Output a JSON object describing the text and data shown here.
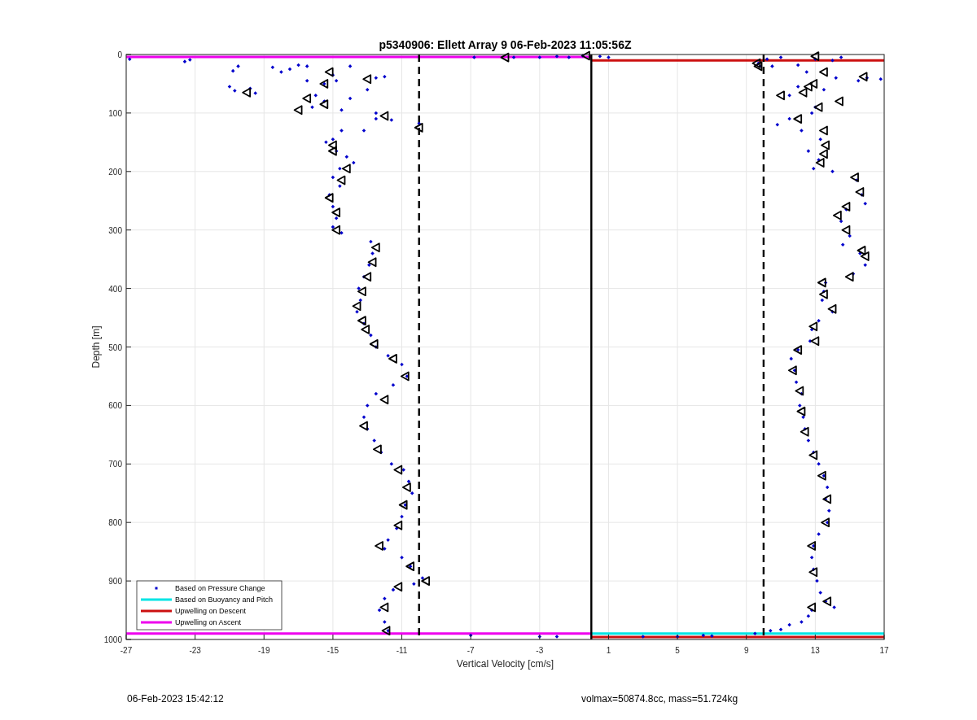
{
  "figure": {
    "chart_data": {
      "type": "scatter",
      "title": "p5340906: Ellett Array 9 06-Feb-2023 11:05:56Z",
      "xlabel": "Vertical Velocity [cm/s]",
      "ylabel": "Depth [m]",
      "xlim": [
        -27,
        17
      ],
      "ylim": [
        1000,
        0
      ],
      "xticks": [
        -27,
        -23,
        -19,
        -15,
        -11,
        -7,
        -3,
        1,
        5,
        9,
        13,
        17
      ],
      "yticks": [
        0,
        100,
        200,
        300,
        400,
        500,
        600,
        700,
        800,
        900,
        1000
      ],
      "series": [
        {
          "name": "Based on Pressure Change",
          "type": "scatter",
          "marker": "diamond",
          "color": "#0000cc",
          "x": [
            -26.8,
            -23.6,
            -23.3,
            -20.5,
            -20.8,
            -21,
            -20.7,
            -19.8,
            -19.5,
            -18.5,
            -18,
            -17.5,
            -17,
            -16.5,
            -16.5,
            -16,
            -15.5,
            -15,
            -14.8,
            -14,
            -12.5,
            -12,
            -13,
            -14,
            -15.5,
            -16.2,
            -14.5,
            -12.5,
            -12.5,
            -11.6,
            -10,
            -13.2,
            -14.5,
            -15,
            -15.4,
            -14.8,
            -14.2,
            -13.8,
            -14.6,
            -15,
            -14.6,
            -15.2,
            -15,
            -14.8,
            -15,
            -14.5,
            -12.8,
            -12.7,
            -12.9,
            -13.2,
            -13.5,
            -13.4,
            -13.6,
            -13.2,
            -12.8,
            -12.5,
            -11.8,
            -11,
            -10.7,
            -11.5,
            -12.5,
            -13,
            -13.2,
            -13,
            -12.6,
            -12.2,
            -11.6,
            -10.9,
            -10.6,
            -10.4,
            -10.8,
            -11,
            -11.3,
            -11.8,
            -12,
            -11,
            -10.5,
            -9.8,
            -10.3,
            -11.5,
            -12,
            -12.3,
            -12,
            -11.8,
            -7,
            -3,
            -2,
            -6.8,
            -4.5,
            -3,
            -2,
            -1.3,
            -0.5,
            0.5,
            1,
            9.7,
            9.8,
            10.2,
            10.5,
            11,
            12,
            13,
            14,
            14.5,
            15.5,
            16,
            16.8,
            12.5,
            11.5,
            12,
            13.5,
            14.2,
            13,
            12.8,
            11.5,
            10.8,
            12.2,
            13.3,
            12.6,
            13.2,
            12.9,
            14,
            15.4,
            15.7,
            15.9,
            14.8,
            14.5,
            15,
            14.6,
            15.6,
            15.9,
            15.2,
            13.6,
            13.5,
            13.4,
            14,
            13.2,
            12.8,
            12.7,
            12,
            11.6,
            11.8,
            11.9,
            12.2,
            12.1,
            12.3,
            12.4,
            12.6,
            12.9,
            13.2,
            13.5,
            13.7,
            13.6,
            13.8,
            13.7,
            13.2,
            12.9,
            12.8,
            12.9,
            13.1,
            13.3,
            13.6,
            14.1,
            12.8,
            12.6,
            12.2,
            11.5,
            11,
            10.4,
            9.5,
            7,
            5,
            3,
            6.5
          ],
          "values": [
            8,
            12,
            9,
            20,
            28,
            55,
            62,
            58,
            66,
            22,
            30,
            25,
            18,
            20,
            45,
            70,
            50,
            35,
            45,
            20,
            40,
            38,
            60,
            75,
            80,
            90,
            95,
            100,
            110,
            112,
            118,
            130,
            130,
            145,
            150,
            165,
            175,
            185,
            195,
            210,
            225,
            240,
            260,
            280,
            295,
            305,
            320,
            340,
            360,
            380,
            400,
            420,
            440,
            460,
            480,
            500,
            515,
            530,
            550,
            565,
            580,
            600,
            620,
            640,
            660,
            680,
            700,
            710,
            730,
            750,
            770,
            790,
            810,
            830,
            845,
            860,
            875,
            895,
            905,
            915,
            930,
            950,
            970,
            985,
            993,
            995,
            995,
            5,
            5,
            5,
            3,
            5,
            2,
            3,
            5,
            15,
            20,
            8,
            20,
            5,
            18,
            8,
            10,
            5,
            45,
            40,
            42,
            30,
            70,
            55,
            60,
            40,
            90,
            100,
            110,
            120,
            130,
            145,
            165,
            180,
            195,
            200,
            215,
            240,
            255,
            265,
            285,
            310,
            325,
            340,
            360,
            375,
            390,
            405,
            420,
            440,
            455,
            470,
            490,
            505,
            520,
            540,
            560,
            580,
            600,
            620,
            640,
            660,
            680,
            700,
            720,
            740,
            760,
            780,
            800,
            820,
            840,
            860,
            880,
            900,
            920,
            935,
            945,
            950,
            960,
            970,
            975,
            983,
            985,
            990,
            994,
            995,
            995,
            993
          ]
        },
        {
          "type": "scatter",
          "marker": "triangle",
          "color": "#000000",
          "x": [
            -15.2,
            -13,
            -10,
            -15.5,
            -20,
            -16.5,
            -15.5,
            -17,
            -12,
            -15,
            -15,
            -14.2,
            -14.5,
            -15.2,
            -14.8,
            -14.8,
            -12.5,
            -12.7,
            -13,
            -13.3,
            -13.6,
            -13.3,
            -13.1,
            -12.6,
            -11.5,
            -10.8,
            -12,
            -13.2,
            -12.4,
            -11.2,
            -10.7,
            -10.9,
            -11.2,
            -12.3,
            -10.5,
            -9.6,
            -11.2,
            -12,
            -11.9,
            -5,
            -0.3,
            13,
            13.5,
            15.8,
            11,
            12.3,
            12.6,
            12.9,
            14.4,
            13.2,
            12,
            13.5,
            13.6,
            13.5,
            13.3,
            15.3,
            15.6,
            14.8,
            14.3,
            14.8,
            15.7,
            15.9,
            15,
            13.4,
            13.5,
            14,
            12.9,
            13,
            12,
            11.7,
            12.1,
            12.2,
            12.4,
            12.9,
            13.4,
            13.7,
            13.6,
            12.8,
            12.9,
            13.7,
            12.8,
            9.6,
            9.7
          ],
          "values": [
            30,
            42,
            125,
            50,
            65,
            75,
            85,
            95,
            105,
            155,
            165,
            195,
            215,
            245,
            270,
            300,
            330,
            355,
            380,
            405,
            430,
            455,
            470,
            495,
            520,
            550,
            590,
            635,
            675,
            710,
            740,
            770,
            805,
            840,
            875,
            900,
            910,
            945,
            985,
            5,
            2,
            3,
            30,
            38,
            70,
            65,
            55,
            50,
            80,
            90,
            110,
            130,
            155,
            170,
            185,
            210,
            235,
            260,
            275,
            300,
            335,
            345,
            380,
            390,
            410,
            435,
            465,
            490,
            505,
            540,
            575,
            610,
            645,
            685,
            720,
            760,
            800,
            840,
            885,
            935,
            945,
            15,
            20
          ]
        },
        {
          "name": "Based on Buoyancy and Pitch",
          "type": "line",
          "color": "#00e5e5",
          "x": [
            0,
            17
          ],
          "values": [
            990,
            990
          ]
        },
        {
          "name": "Upwelling on Descent",
          "type": "line",
          "color": "#cc1010",
          "x": [
            0,
            17
          ],
          "values": [
            10,
            10
          ]
        },
        {
          "type": "line",
          "color": "#cc1010",
          "x": [
            0,
            17
          ],
          "values": [
            996,
            996
          ]
        },
        {
          "name": "Upwelling on Ascent",
          "type": "line",
          "color": "#ee00ee",
          "x": [
            -27,
            0
          ],
          "values": [
            4,
            4
          ]
        },
        {
          "type": "line",
          "color": "#ee00ee",
          "x": [
            -27,
            0
          ],
          "values": [
            990,
            990
          ]
        },
        {
          "type": "line",
          "color": "#000000",
          "line_style": "dashed",
          "x": [
            -10,
            -10
          ],
          "values": [
            0,
            1000
          ]
        },
        {
          "type": "line",
          "color": "#000000",
          "line_style": "solid",
          "x": [
            0,
            0
          ],
          "values": [
            0,
            1000
          ]
        },
        {
          "type": "line",
          "color": "#000000",
          "line_style": "dashed",
          "x": [
            10,
            10
          ],
          "values": [
            0,
            1000
          ]
        }
      ],
      "grid": true,
      "legend": true
    }
  },
  "footer": {
    "timestamp": "06-Feb-2023 15:42:12",
    "summary": "volmax=50874.8cc, mass=51.724kg"
  }
}
